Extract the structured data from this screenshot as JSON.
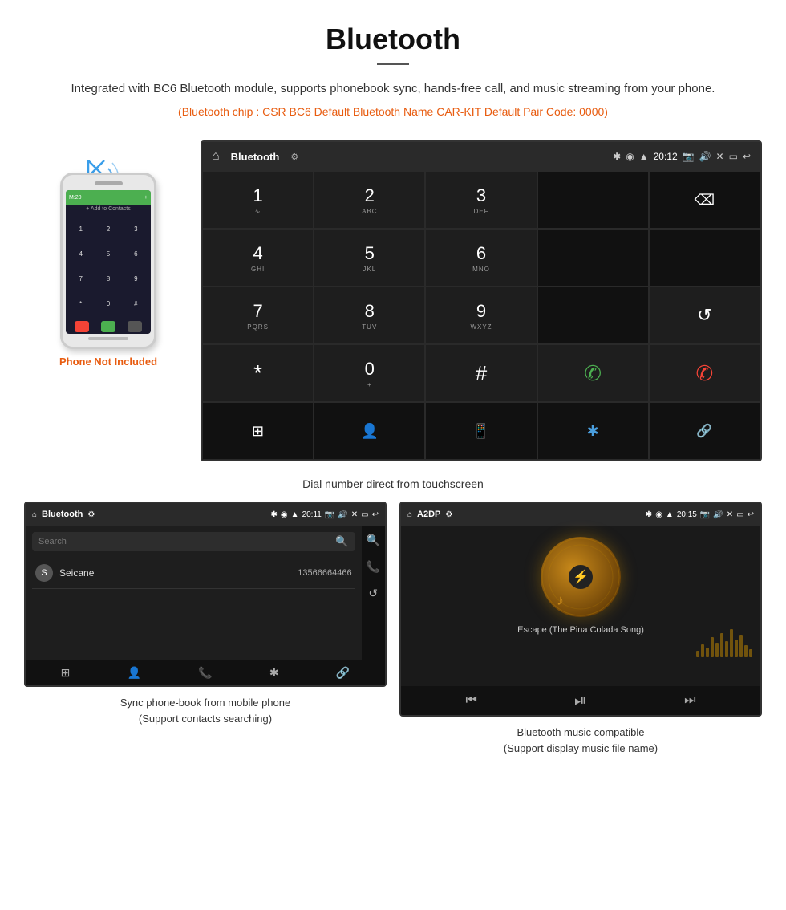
{
  "header": {
    "title": "Bluetooth",
    "description": "Integrated with BC6 Bluetooth module, supports phonebook sync, hands-free call, and music streaming from your phone.",
    "specs": "(Bluetooth chip : CSR BC6   Default Bluetooth Name CAR-KIT    Default Pair Code: 0000)"
  },
  "phone_label": "Phone Not Included",
  "dial_screen": {
    "topbar": {
      "title": "Bluetooth",
      "time": "20:12"
    },
    "keys": [
      {
        "num": "1",
        "sub": "∿"
      },
      {
        "num": "2",
        "sub": "ABC"
      },
      {
        "num": "3",
        "sub": "DEF"
      },
      {
        "num": "4",
        "sub": "GHI"
      },
      {
        "num": "5",
        "sub": "JKL"
      },
      {
        "num": "6",
        "sub": "MNO"
      },
      {
        "num": "7",
        "sub": "PQRS"
      },
      {
        "num": "8",
        "sub": "TUV"
      },
      {
        "num": "9",
        "sub": "WXYZ"
      },
      {
        "num": "*",
        "sub": ""
      },
      {
        "num": "0",
        "sub": "+"
      },
      {
        "num": "#",
        "sub": ""
      }
    ]
  },
  "dial_caption": "Dial number direct from touchscreen",
  "phonebook_screen": {
    "topbar_title": "Bluetooth",
    "topbar_time": "20:11",
    "search_placeholder": "Search",
    "contacts": [
      {
        "letter": "S",
        "name": "Seicane",
        "number": "13566664466"
      }
    ]
  },
  "music_screen": {
    "topbar_title": "A2DP",
    "topbar_time": "20:15",
    "song_title": "Escape (The Pina Colada Song)"
  },
  "bottom_captions": {
    "phonebook": "Sync phone-book from mobile phone\n(Support contacts searching)",
    "music": "Bluetooth music compatible\n(Support display music file name)"
  },
  "icons": {
    "home": "⌂",
    "back": "↩",
    "bluetooth": "⚡",
    "usb": "⚙",
    "camera": "📷",
    "volume": "🔊",
    "close": "✕",
    "menu": "▭",
    "backspace": "⌫",
    "redial": "↺",
    "call_green": "📞",
    "hangup_red": "📵",
    "grid": "⊞",
    "person": "👤",
    "phone": "📱",
    "bt": "⚡",
    "link": "🔗",
    "search": "🔍",
    "prev": "⏮",
    "play": "⏯",
    "next": "⏭"
  }
}
